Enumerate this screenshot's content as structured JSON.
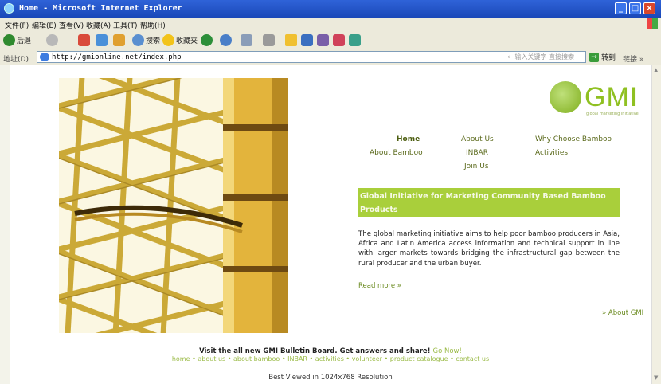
{
  "window": {
    "title": "Home - Microsoft Internet Explorer",
    "controls": [
      "_",
      "□",
      "×"
    ]
  },
  "menu": [
    "文件(F)",
    "编辑(E)",
    "查看(V)",
    "收藏(A)",
    "工具(T)",
    "帮助(H)"
  ],
  "toolbar": {
    "back": "后退",
    "search": "搜索",
    "favorites": "收藏夹"
  },
  "address": {
    "label": "地址(D)",
    "url": "http://gmionline.net/index.php",
    "search_hint": "← 输入关键字 直接搜索",
    "go": "转到",
    "links": "链接 »"
  },
  "logo": {
    "name": "GMI",
    "tagline": "global marketing initiative"
  },
  "nav": [
    {
      "label": "Home",
      "active": true
    },
    {
      "label": "About Us"
    },
    {
      "label": "Why Choose Bamboo"
    },
    {
      "label": "About Bamboo"
    },
    {
      "label": "INBAR"
    },
    {
      "label": "Activities"
    },
    {
      "label": "Join Us"
    }
  ],
  "banner": "Global Initiative for Marketing Community Based Bamboo Products",
  "intro": "The global marketing initiative aims to help poor bamboo producers in Asia, Africa and Latin America access information and technical support in line with larger markets towards bridging the infrastructural gap between the rural producer and the urban buyer.",
  "read_more": "Read more »",
  "about_gmi": "» About GMI",
  "bulletin": {
    "text": "Visit the all new GMI Bulletin Board. Get answers and share!",
    "link": "Go Now!"
  },
  "footer_links": [
    "home",
    "about us",
    "about bamboo",
    "INBAR",
    "activities",
    "volunteer",
    "product catalogue",
    "contact us"
  ],
  "best_viewed": "Best Viewed in 1024x768 Resolution",
  "colors": {
    "brand_green": "#8fc021",
    "banner_green": "#a9cf3b",
    "nav_text": "#5b6a1c"
  }
}
